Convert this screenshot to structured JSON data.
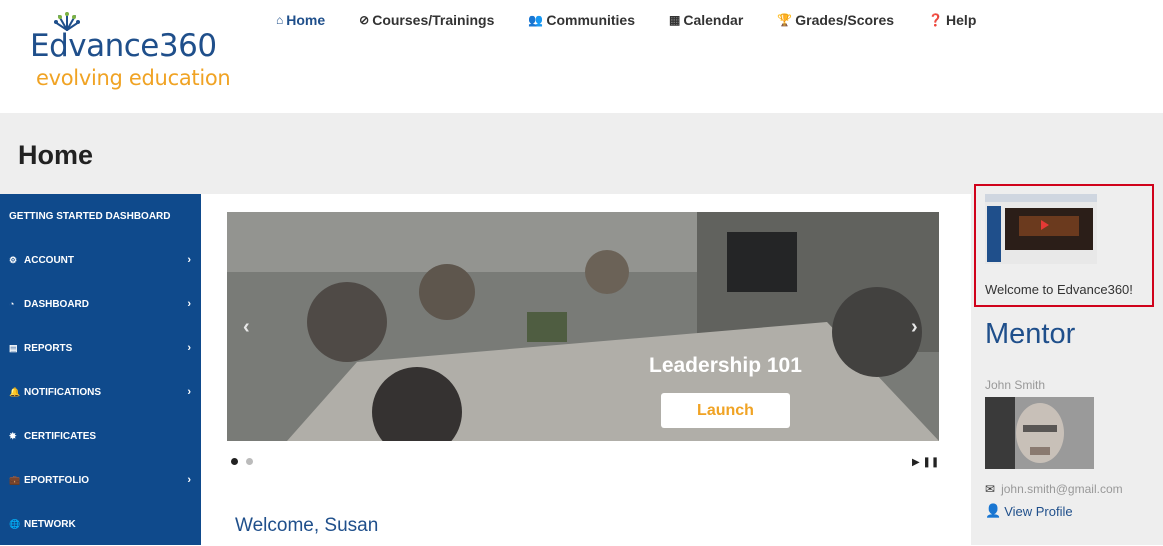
{
  "brand": {
    "name_word": "Edvance",
    "name_num": "360",
    "tagline": "evolving education",
    "primary": "#1f4f8b",
    "accent": "#f0a324"
  },
  "nav": [
    {
      "icon": "home-icon",
      "glyph": "⌂",
      "label": "Home"
    },
    {
      "icon": "compass-icon",
      "glyph": "⊘",
      "label": "Courses/Trainings"
    },
    {
      "icon": "users-icon",
      "glyph": "👥",
      "label": "Communities"
    },
    {
      "icon": "calendar-icon",
      "glyph": "▦",
      "label": "Calendar"
    },
    {
      "icon": "trophy-icon",
      "glyph": "🏆",
      "label": "Grades/Scores"
    },
    {
      "icon": "help-icon",
      "glyph": "❓",
      "label": "Help"
    }
  ],
  "page_title": "Home",
  "sidebar": [
    {
      "label": "GETTING STARTED DASHBOARD",
      "icon": "",
      "chevron": false
    },
    {
      "label": "ACCOUNT",
      "icon": "cogs-icon",
      "glyph": "⚙",
      "chevron": true
    },
    {
      "label": "DASHBOARD",
      "icon": "dashboard-icon",
      "glyph": "◔",
      "chevron": true
    },
    {
      "label": "REPORTS",
      "icon": "reports-icon",
      "glyph": "▤",
      "chevron": true
    },
    {
      "label": "NOTIFICATIONS",
      "icon": "bell-icon",
      "glyph": "🔔",
      "chevron": true
    },
    {
      "label": "CERTIFICATES",
      "icon": "certificate-icon",
      "glyph": "✸",
      "chevron": false
    },
    {
      "label": "EPORTFOLIO",
      "icon": "briefcase-icon",
      "glyph": "💼",
      "chevron": true
    },
    {
      "label": "NETWORK",
      "icon": "globe-icon",
      "glyph": "🌐",
      "chevron": false
    }
  ],
  "carousel": {
    "slide_title": "Leadership 101",
    "launch_label": "Launch",
    "slides": 2,
    "active_slide": 1
  },
  "welcome": "Welcome,  Susan",
  "video": {
    "caption": "Welcome to Edvance360!"
  },
  "mentor": {
    "title": "Mentor",
    "name": "John Smith",
    "email": "john.smith@gmail.com",
    "profile_label": "View Profile"
  }
}
